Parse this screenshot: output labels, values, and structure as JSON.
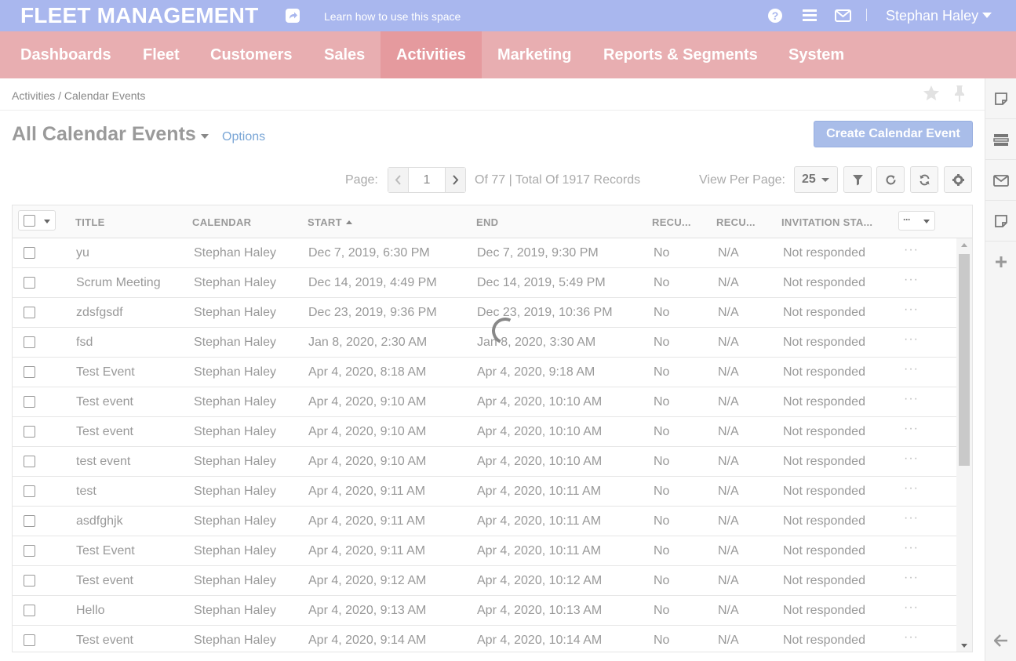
{
  "header": {
    "brand": "FLEET MANAGEMENT",
    "learn_link": "Learn how to use this space",
    "help_glyph": "?",
    "user_name": "Stephan Haley"
  },
  "nav": {
    "items": [
      {
        "label": "Dashboards"
      },
      {
        "label": "Fleet"
      },
      {
        "label": "Customers"
      },
      {
        "label": "Sales"
      },
      {
        "label": "Activities",
        "active": true
      },
      {
        "label": "Marketing"
      },
      {
        "label": "Reports & Segments"
      },
      {
        "label": "System"
      }
    ]
  },
  "breadcrumb": {
    "text": "Activities / Calendar Events"
  },
  "page": {
    "title": "All Calendar Events",
    "options_label": "Options",
    "create_button": "Create Calendar Event"
  },
  "pagination": {
    "page_label": "Page:",
    "current_page": "1",
    "total_text": "Of 77 | Total Of 1917 Records",
    "view_per_page_label": "View Per Page:",
    "per_page": "25"
  },
  "table": {
    "columns": {
      "title": "TITLE",
      "calendar": "CALENDAR",
      "start": "START",
      "end": "END",
      "recurring": "RECU...",
      "recurrence": "RECU...",
      "invitation_status": "INVITATION STA..."
    },
    "more_glyph": "···",
    "rows": [
      {
        "title": "yu",
        "calendar": "Stephan Haley",
        "start": "Dec 7, 2019, 6:30 PM",
        "end": "Dec 7, 2019, 9:30 PM",
        "recurring": "No",
        "recurrence": "N/A",
        "status": "Not responded"
      },
      {
        "title": "Scrum Meeting",
        "calendar": "Stephan Haley",
        "start": "Dec 14, 2019, 4:49 PM",
        "end": "Dec 14, 2019, 5:49 PM",
        "recurring": "No",
        "recurrence": "N/A",
        "status": "Not responded"
      },
      {
        "title": "zdsfgsdf",
        "calendar": "Stephan Haley",
        "start": "Dec 23, 2019, 9:36 PM",
        "end": "Dec 23, 2019, 10:36 PM",
        "recurring": "No",
        "recurrence": "N/A",
        "status": "Not responded"
      },
      {
        "title": "fsd",
        "calendar": "Stephan Haley",
        "start": "Jan 8, 2020, 2:30 AM",
        "end": "Jan 8, 2020, 3:30 AM",
        "recurring": "No",
        "recurrence": "N/A",
        "status": "Not responded"
      },
      {
        "title": "Test Event",
        "calendar": "Stephan Haley",
        "start": "Apr 4, 2020, 8:18 AM",
        "end": "Apr 4, 2020, 9:18 AM",
        "recurring": "No",
        "recurrence": "N/A",
        "status": "Not responded"
      },
      {
        "title": "Test event",
        "calendar": "Stephan Haley",
        "start": "Apr 4, 2020, 9:10 AM",
        "end": "Apr 4, 2020, 10:10 AM",
        "recurring": "No",
        "recurrence": "N/A",
        "status": "Not responded"
      },
      {
        "title": "Test event",
        "calendar": "Stephan Haley",
        "start": "Apr 4, 2020, 9:10 AM",
        "end": "Apr 4, 2020, 10:10 AM",
        "recurring": "No",
        "recurrence": "N/A",
        "status": "Not responded"
      },
      {
        "title": "test event",
        "calendar": "Stephan Haley",
        "start": "Apr 4, 2020, 9:10 AM",
        "end": "Apr 4, 2020, 10:10 AM",
        "recurring": "No",
        "recurrence": "N/A",
        "status": "Not responded"
      },
      {
        "title": "test",
        "calendar": "Stephan Haley",
        "start": "Apr 4, 2020, 9:11 AM",
        "end": "Apr 4, 2020, 10:11 AM",
        "recurring": "No",
        "recurrence": "N/A",
        "status": "Not responded"
      },
      {
        "title": "asdfghjk",
        "calendar": "Stephan Haley",
        "start": "Apr 4, 2020, 9:11 AM",
        "end": "Apr 4, 2020, 10:11 AM",
        "recurring": "No",
        "recurrence": "N/A",
        "status": "Not responded"
      },
      {
        "title": "Test Event",
        "calendar": "Stephan Haley",
        "start": "Apr 4, 2020, 9:11 AM",
        "end": "Apr 4, 2020, 10:11 AM",
        "recurring": "No",
        "recurrence": "N/A",
        "status": "Not responded"
      },
      {
        "title": "Test event",
        "calendar": "Stephan Haley",
        "start": "Apr 4, 2020, 9:12 AM",
        "end": "Apr 4, 2020, 10:12 AM",
        "recurring": "No",
        "recurrence": "N/A",
        "status": "Not responded"
      },
      {
        "title": "Hello",
        "calendar": "Stephan Haley",
        "start": "Apr 4, 2020, 9:13 AM",
        "end": "Apr 4, 2020, 10:13 AM",
        "recurring": "No",
        "recurrence": "N/A",
        "status": "Not responded"
      },
      {
        "title": "Test event",
        "calendar": "Stephan Haley",
        "start": "Apr 4, 2020, 9:14 AM",
        "end": "Apr 4, 2020, 10:14 AM",
        "recurring": "No",
        "recurrence": "N/A",
        "status": "Not responded"
      }
    ]
  },
  "icons": {
    "share": "share-icon",
    "help": "help-icon",
    "menu": "hamburger-menu-icon",
    "mail": "envelope-icon",
    "star": "star-icon",
    "pin": "pin-icon",
    "filter": "filter-icon",
    "reset": "reset-icon",
    "refresh": "refresh-icon",
    "settings": "gear-icon",
    "sidebar": [
      "sticky-note-icon",
      "list-panel-icon",
      "envelope-icon",
      "note-icon",
      "plus-icon"
    ],
    "collapse": "arrow-left-icon"
  },
  "colors": {
    "topbar": "#a9b7ee",
    "nav": "#e8aeb1",
    "nav_active": "#e59a9e",
    "primary_button": "#a9bde9",
    "link": "#7aa6d6"
  }
}
